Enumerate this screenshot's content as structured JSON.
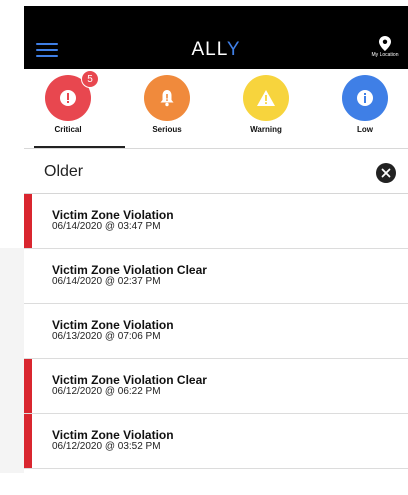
{
  "header": {
    "brand_main": "ALL",
    "brand_accent": "Y",
    "location_label": "My Location"
  },
  "filters": [
    {
      "label": "Critical",
      "color": "#e8474f",
      "icon": "exclamation-icon",
      "badge": "5"
    },
    {
      "label": "Serious",
      "color": "#f08a3c",
      "icon": "bell-icon"
    },
    {
      "label": "Warning",
      "color": "#f7d43d",
      "icon": "warning-triangle-icon"
    },
    {
      "label": "Low",
      "color": "#3f7fe6",
      "icon": "info-icon"
    }
  ],
  "section": {
    "title": "Older"
  },
  "alerts": [
    {
      "title": "Victim Zone Violation",
      "timestamp": "06/14/2020 @ 03:47 PM"
    },
    {
      "title": "Victim Zone Violation Clear",
      "timestamp": "06/14/2020 @ 02:37 PM"
    },
    {
      "title": "Victim Zone Violation",
      "timestamp": "06/13/2020 @ 07:06 PM"
    },
    {
      "title": "Victim Zone Violation Clear",
      "timestamp": "06/12/2020 @ 06:22 PM"
    },
    {
      "title": "Victim Zone Violation",
      "timestamp": "06/12/2020 @ 03:52 PM"
    }
  ],
  "colors": {
    "accent": "#3f7fe6",
    "critical_bar": "#d9262f"
  }
}
